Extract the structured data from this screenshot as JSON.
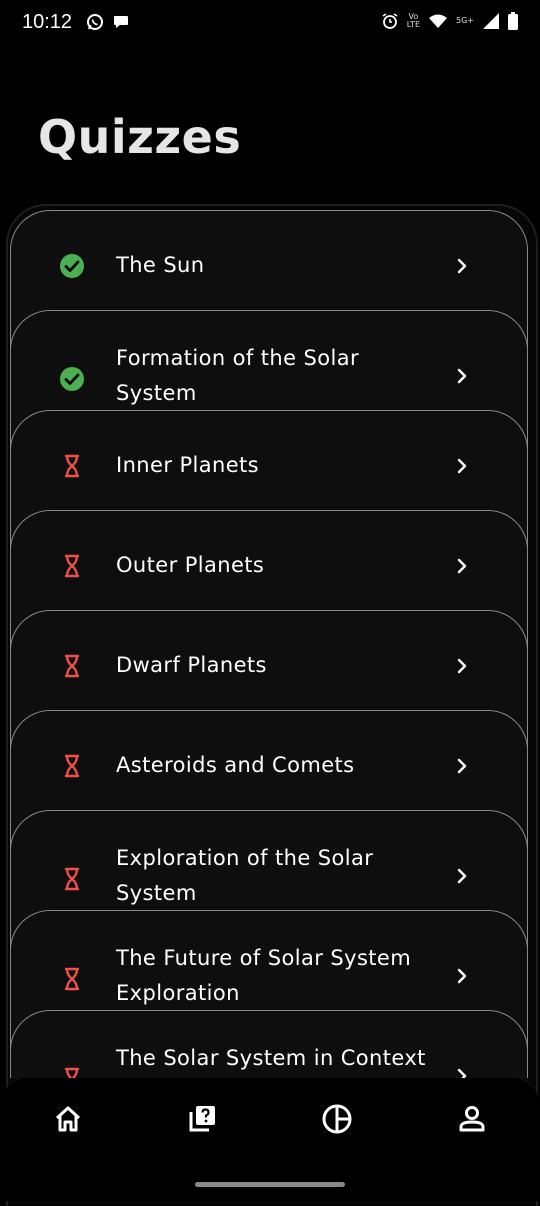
{
  "status_bar": {
    "time": "10:12",
    "vo_label": "Vo",
    "lte_label": "LTE",
    "network_label": "5G+"
  },
  "header": {
    "title": "Quizzes"
  },
  "quizzes": [
    {
      "label": "The Sun",
      "status": "completed"
    },
    {
      "label": "Formation of the Solar System",
      "status": "completed"
    },
    {
      "label": "Inner Planets",
      "status": "pending"
    },
    {
      "label": "Outer Planets",
      "status": "pending"
    },
    {
      "label": "Dwarf Planets",
      "status": "pending"
    },
    {
      "label": "Asteroids and Comets",
      "status": "pending"
    },
    {
      "label": "Exploration of the Solar System",
      "status": "pending"
    },
    {
      "label": "The Future of Solar System Exploration",
      "status": "pending"
    },
    {
      "label": "The Solar System in Context",
      "status": "pending"
    }
  ],
  "icons": {
    "completed": "check-circle-icon",
    "pending": "hourglass-icon",
    "row_action": "chevron-right-icon"
  },
  "colors": {
    "completed": "#4caf50",
    "pending": "#f0504a"
  },
  "bottom_nav": [
    {
      "icon": "home-icon",
      "label": "Home"
    },
    {
      "icon": "quiz-icon",
      "label": "Quizzes"
    },
    {
      "icon": "progress-icon",
      "label": "Progress"
    },
    {
      "icon": "profile-icon",
      "label": "Profile"
    }
  ]
}
